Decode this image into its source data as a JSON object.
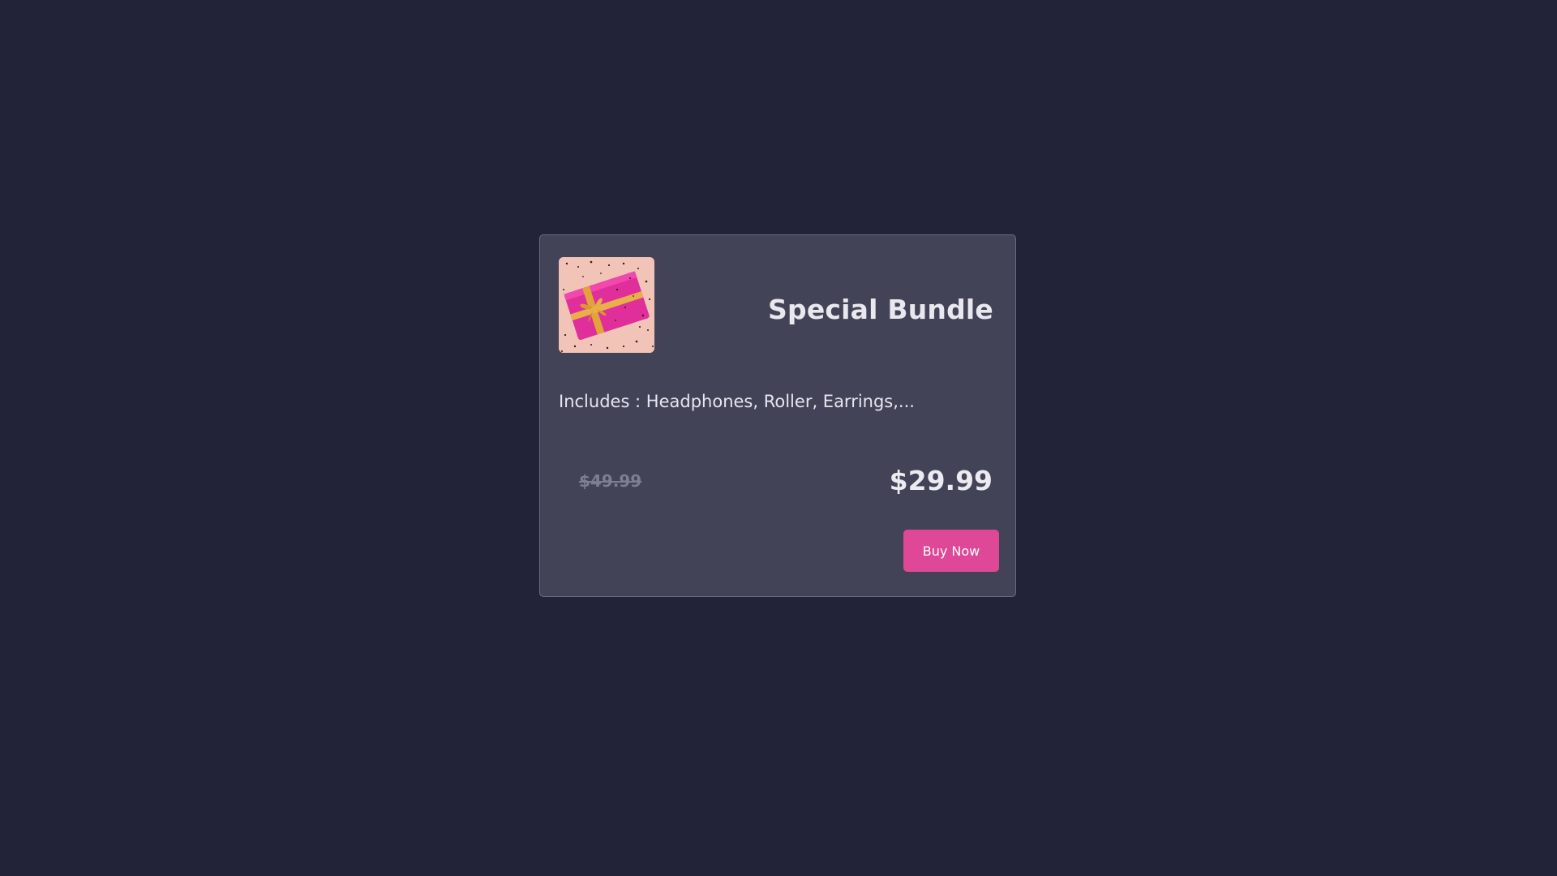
{
  "product": {
    "title": "Special Bundle",
    "description": "Includes : Headphones, Roller, Earrings,...",
    "old_price": "$49.99",
    "new_price": "$29.99",
    "buy_label": "Buy Now",
    "image_icon": "gift-box-icon"
  },
  "colors": {
    "background": "#222339",
    "card": "#434358",
    "accent": "#de4896",
    "old_price": "#7e7e92"
  }
}
